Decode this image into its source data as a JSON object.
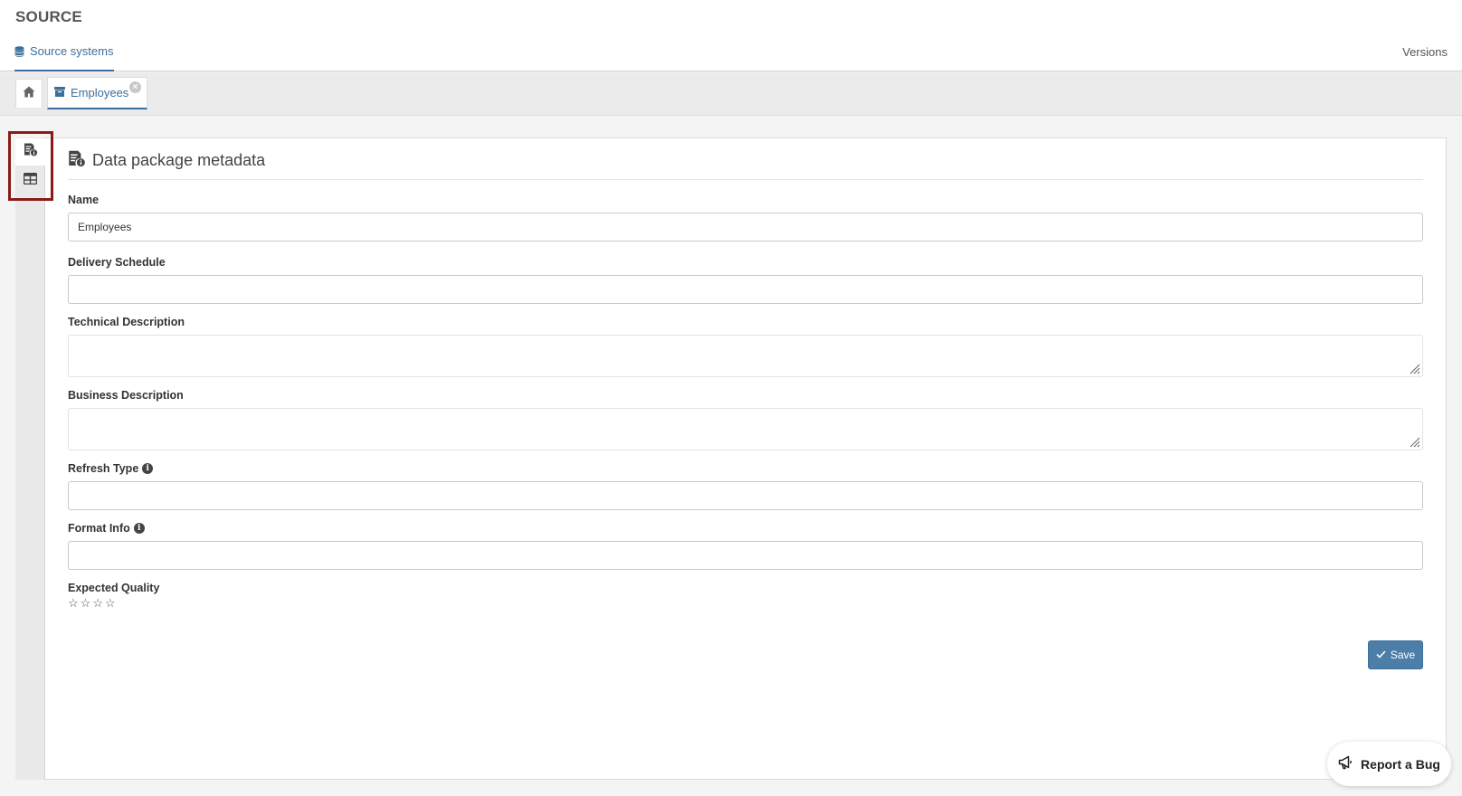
{
  "app": {
    "title": "SOURCE"
  },
  "nav": {
    "source_systems": "Source systems",
    "versions": "Versions"
  },
  "tabs": [
    {
      "label": "Employees",
      "close": "×"
    }
  ],
  "section": {
    "title": "Data package metadata"
  },
  "form": {
    "name": {
      "label": "Name",
      "value": "Employees"
    },
    "delivery_schedule": {
      "label": "Delivery Schedule",
      "value": ""
    },
    "technical_description": {
      "label": "Technical Description",
      "value": ""
    },
    "business_description": {
      "label": "Business Description",
      "value": ""
    },
    "refresh_type": {
      "label": "Refresh Type",
      "value": "",
      "info_icon": "info-icon"
    },
    "format_info": {
      "label": "Format Info",
      "value": "",
      "info_icon": "info-icon"
    },
    "expected_quality": {
      "label": "Expected Quality",
      "rating": 0,
      "max": 4,
      "star_glyph": "☆"
    }
  },
  "actions": {
    "save": "Save",
    "report_bug": "Report a Bug"
  },
  "icons": {
    "database": "database-icon",
    "home": "home-icon",
    "archive": "archive-icon",
    "metadata": "document-info-icon",
    "table": "table-icon",
    "check": "check-icon",
    "megaphone": "megaphone-icon"
  },
  "colors": {
    "accent": "#3c6e9c",
    "save_bg": "#4d7ea8",
    "highlight": "#8b1a1a"
  }
}
